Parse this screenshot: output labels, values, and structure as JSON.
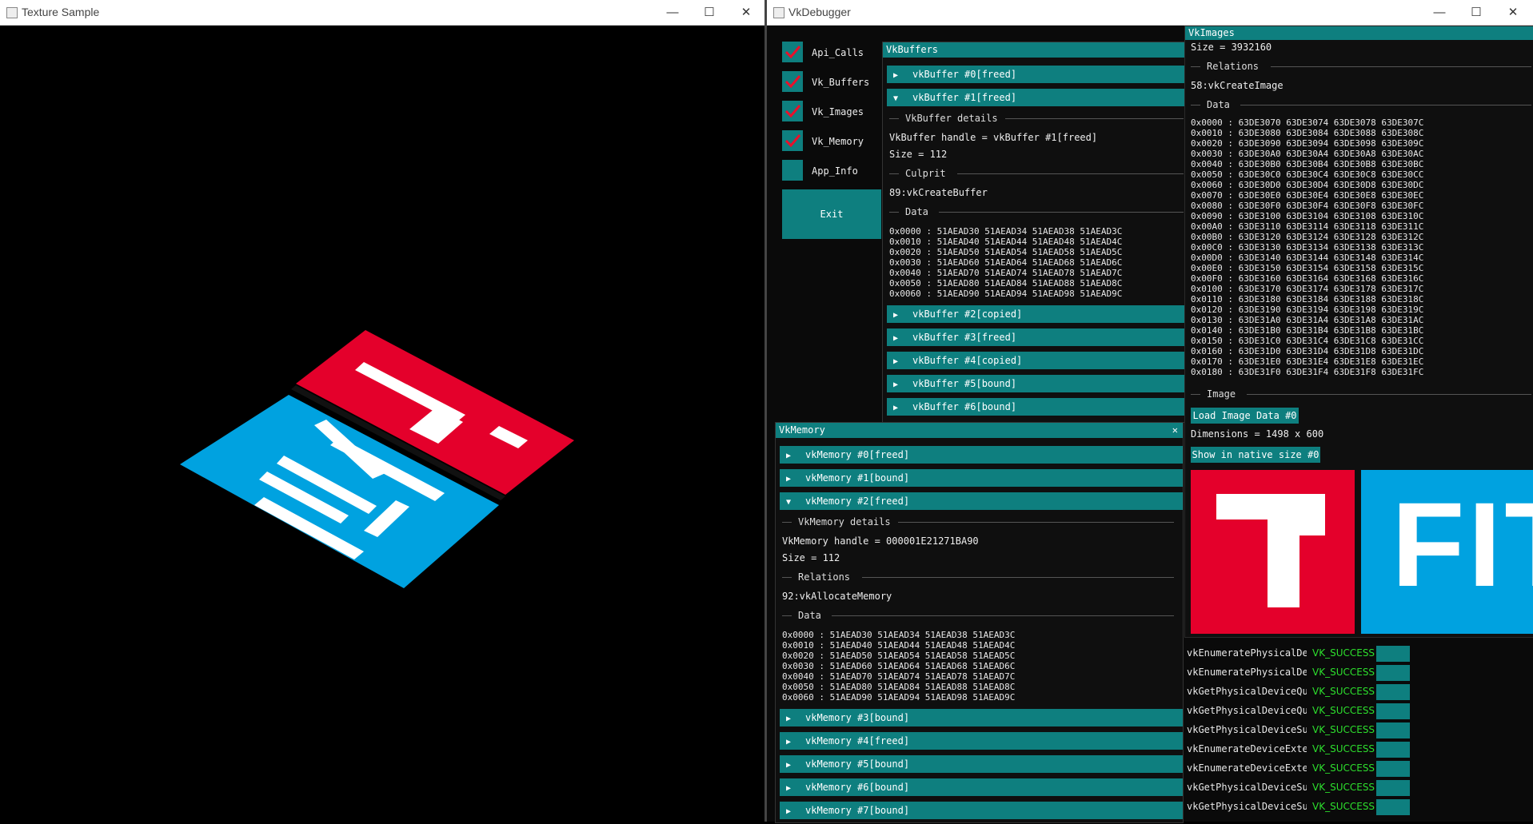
{
  "left_window": {
    "title": "Texture Sample",
    "min": "—",
    "max": "☐",
    "close": "✕"
  },
  "right_window": {
    "title": "VkDebugger",
    "min": "—",
    "max": "☐",
    "close": "✕"
  },
  "menu": {
    "checkboxes": [
      {
        "label": "Api_Calls",
        "checked": true
      },
      {
        "label": "Vk_Buffers",
        "checked": true
      },
      {
        "label": "Vk_Images",
        "checked": true
      },
      {
        "label": "Vk_Memory",
        "checked": true
      },
      {
        "label": "App_Info",
        "checked": false
      }
    ],
    "exit_label": "Exit"
  },
  "vkbuffers": {
    "title": "VkBuffers",
    "headers_top": [
      {
        "label": "vkBuffer #0[freed]",
        "arrow": "▶"
      },
      {
        "label": "vkBuffer #1[freed]",
        "arrow": "▼"
      }
    ],
    "details_label": "VkBuffer details",
    "handle": "VkBuffer handle = vkBuffer #1[freed]",
    "size": "Size = 112",
    "culprit_label": "Culprit",
    "culprit": "89:vkCreateBuffer",
    "data_label": "Data",
    "data": "0x0000 : 51AEAD30 51AEAD34 51AEAD38 51AEAD3C\n0x0010 : 51AEAD40 51AEAD44 51AEAD48 51AEAD4C\n0x0020 : 51AEAD50 51AEAD54 51AEAD58 51AEAD5C\n0x0030 : 51AEAD60 51AEAD64 51AEAD68 51AEAD6C\n0x0040 : 51AEAD70 51AEAD74 51AEAD78 51AEAD7C\n0x0050 : 51AEAD80 51AEAD84 51AEAD88 51AEAD8C\n0x0060 : 51AEAD90 51AEAD94 51AEAD98 51AEAD9C",
    "headers_bottom": [
      {
        "label": "vkBuffer #2[copied]",
        "arrow": "▶"
      },
      {
        "label": "vkBuffer #3[freed]",
        "arrow": "▶"
      },
      {
        "label": "vkBuffer #4[copied]",
        "arrow": "▶"
      },
      {
        "label": "vkBuffer #5[bound]",
        "arrow": "▶"
      },
      {
        "label": "vkBuffer #6[bound]",
        "arrow": "▶"
      }
    ]
  },
  "vkmemory": {
    "title": "VkMemory",
    "close": "✕",
    "headers_top": [
      {
        "label": "vkMemory #0[freed]",
        "arrow": "▶"
      },
      {
        "label": "vkMemory #1[bound]",
        "arrow": "▶"
      },
      {
        "label": "vkMemory #2[freed]",
        "arrow": "▼"
      }
    ],
    "details_label": "VkMemory details",
    "handle": "VkMemory handle = 000001E21271BA90",
    "size": "Size = 112",
    "relations_label": "Relations",
    "relation": "92:vkAllocateMemory",
    "data_label": "Data",
    "data": "0x0000 : 51AEAD30 51AEAD34 51AEAD38 51AEAD3C\n0x0010 : 51AEAD40 51AEAD44 51AEAD48 51AEAD4C\n0x0020 : 51AEAD50 51AEAD54 51AEAD58 51AEAD5C\n0x0030 : 51AEAD60 51AEAD64 51AEAD68 51AEAD6C\n0x0040 : 51AEAD70 51AEAD74 51AEAD78 51AEAD7C\n0x0050 : 51AEAD80 51AEAD84 51AEAD88 51AEAD8C\n0x0060 : 51AEAD90 51AEAD94 51AEAD98 51AEAD9C",
    "headers_bottom": [
      {
        "label": "vkMemory #3[bound]",
        "arrow": "▶"
      },
      {
        "label": "vkMemory #4[freed]",
        "arrow": "▶"
      },
      {
        "label": "vkMemory #5[bound]",
        "arrow": "▶"
      },
      {
        "label": "vkMemory #6[bound]",
        "arrow": "▶"
      },
      {
        "label": "vkMemory #7[bound]",
        "arrow": "▶"
      }
    ]
  },
  "vkimages": {
    "title": "VkImages",
    "size": "Size = 3932160",
    "relations_label": "Relations",
    "relation": "58:vkCreateImage",
    "data_label": "Data",
    "data": "0x0000 : 63DE3070 63DE3074 63DE3078 63DE307C\n0x0010 : 63DE3080 63DE3084 63DE3088 63DE308C\n0x0020 : 63DE3090 63DE3094 63DE3098 63DE309C\n0x0030 : 63DE30A0 63DE30A4 63DE30A8 63DE30AC\n0x0040 : 63DE30B0 63DE30B4 63DE30B8 63DE30BC\n0x0050 : 63DE30C0 63DE30C4 63DE30C8 63DE30CC\n0x0060 : 63DE30D0 63DE30D4 63DE30D8 63DE30DC\n0x0070 : 63DE30E0 63DE30E4 63DE30E8 63DE30EC\n0x0080 : 63DE30F0 63DE30F4 63DE30F8 63DE30FC\n0x0090 : 63DE3100 63DE3104 63DE3108 63DE310C\n0x00A0 : 63DE3110 63DE3114 63DE3118 63DE311C\n0x00B0 : 63DE3120 63DE3124 63DE3128 63DE312C\n0x00C0 : 63DE3130 63DE3134 63DE3138 63DE313C\n0x00D0 : 63DE3140 63DE3144 63DE3148 63DE314C\n0x00E0 : 63DE3150 63DE3154 63DE3158 63DE315C\n0x00F0 : 63DE3160 63DE3164 63DE3168 63DE316C\n0x0100 : 63DE3170 63DE3174 63DE3178 63DE317C\n0x0110 : 63DE3180 63DE3184 63DE3188 63DE318C\n0x0120 : 63DE3190 63DE3194 63DE3198 63DE319C\n0x0130 : 63DE31A0 63DE31A4 63DE31A8 63DE31AC\n0x0140 : 63DE31B0 63DE31B4 63DE31B8 63DE31BC\n0x0150 : 63DE31C0 63DE31C4 63DE31C8 63DE31CC\n0x0160 : 63DE31D0 63DE31D4 63DE31D8 63DE31DC\n0x0170 : 63DE31E0 63DE31E4 63DE31E8 63DE31EC\n0x0180 : 63DE31F0 63DE31F4 63DE31F8 63DE31FC",
    "image_label": "Image",
    "load_button": "Load Image Data #0",
    "dimensions": "Dimensions = 1498 x 600",
    "native_button": "Show in native size #0",
    "preview_text": "FIT"
  },
  "api_calls": [
    {
      "name": "vkEnumeratePhysicalDev",
      "result": "VK_SUCCESS"
    },
    {
      "name": "vkEnumeratePhysicalDev",
      "result": "VK_SUCCESS"
    },
    {
      "name": "vkGetPhysicalDeviceQue",
      "result": "VK_SUCCESS"
    },
    {
      "name": "vkGetPhysicalDeviceQue",
      "result": "VK_SUCCESS"
    },
    {
      "name": "vkGetPhysicalDeviceSur",
      "result": "VK_SUCCESS"
    },
    {
      "name": "vkEnumerateDeviceExter",
      "result": "VK_SUCCESS"
    },
    {
      "name": "vkEnumerateDeviceExter",
      "result": "VK_SUCCESS"
    },
    {
      "name": "vkGetPhysicalDeviceSur",
      "result": "VK_SUCCESS"
    },
    {
      "name": "vkGetPhysicalDeviceSur",
      "result": "VK_SUCCESS"
    }
  ],
  "colors": {
    "accent": "#0e7f7f",
    "logo_red": "#e4002b",
    "logo_blue": "#00a2e0",
    "success": "#2ddf2d",
    "check": "#e8102b"
  }
}
